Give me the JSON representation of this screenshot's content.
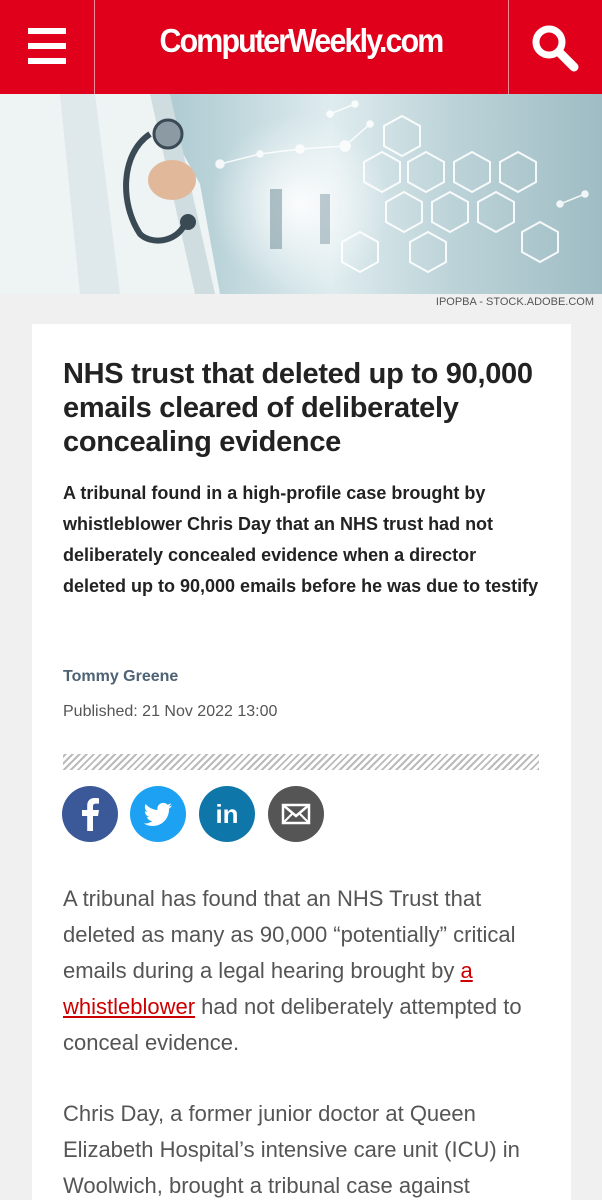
{
  "header": {
    "logo": "ComputerWeekly.com",
    "menu_icon": "hamburger-menu-icon",
    "search_icon": "search-icon",
    "brand_color": "#e0001b"
  },
  "hero": {
    "credit": "IPOPBA - STOCK.ADOBE.COM"
  },
  "article": {
    "title": "NHS trust that deleted up to 90,000 emails cleared of deliberately concealing evidence",
    "standfirst": "A tribunal found in a high-profile case brought by whistleblower Chris Day that an NHS trust had not deliberately concealed evidence when a director deleted up to 90,000 emails before he was due to testify",
    "author": "Tommy Greene",
    "published": "Published: 21 Nov 2022 13:00",
    "share": [
      {
        "network": "facebook",
        "icon": "facebook-icon",
        "color": "#3b5998"
      },
      {
        "network": "twitter",
        "icon": "twitter-icon",
        "color": "#1da1f2"
      },
      {
        "network": "linkedin",
        "icon": "linkedin-icon",
        "color": "#0e76a8"
      },
      {
        "network": "email",
        "icon": "email-icon",
        "color": "#555555"
      }
    ],
    "paragraph1": {
      "before": "A tribunal has found that an NHS Trust that deleted as many as 90,000 “potentially” critical emails during a legal hearing brought by ",
      "link": "a whistleblower",
      "after": " had not deliberately attempted to conceal evidence."
    },
    "paragraph2": "Chris Day, a former junior doctor at Queen Elizabeth Hospital’s intensive care unit (ICU) in Woolwich, brought a tribunal case against"
  }
}
